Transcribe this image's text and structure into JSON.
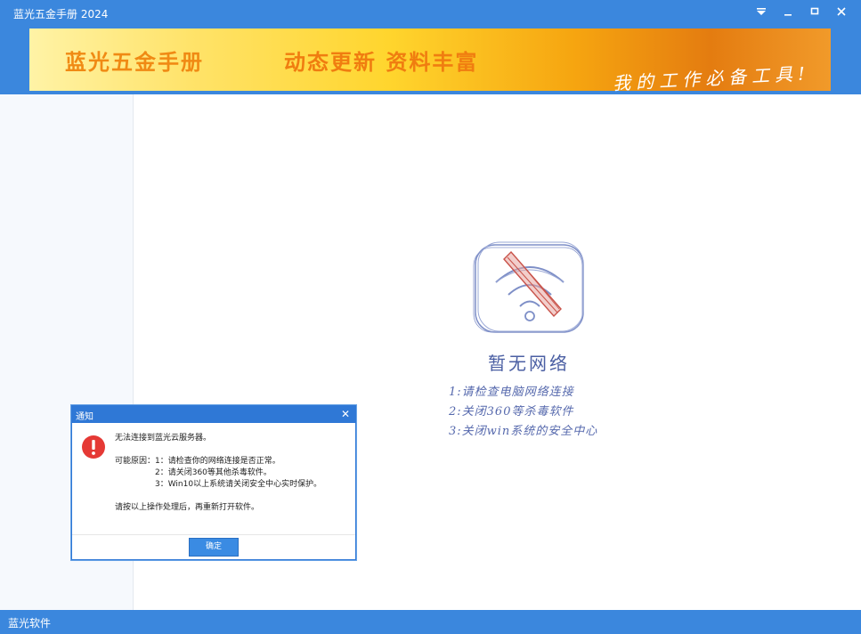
{
  "window": {
    "title": "蓝光五金手册 2024"
  },
  "banner": {
    "title": "蓝光五金手册",
    "slogan": "动态更新 资料丰富",
    "tagline": "我的工作必备工具!"
  },
  "no_network": {
    "title": "暂无网络",
    "tips": [
      "1:请检查电脑网络连接",
      "2:关闭360等杀毒软件",
      "3:关闭win系统的安全中心"
    ]
  },
  "status_bar": {
    "text": "蓝光软件"
  },
  "dialog": {
    "title": "通知",
    "message": "无法连接到蓝光云服务器。",
    "reasons_label": "可能原因：",
    "reasons": [
      "1：请检查你的网络连接是否正常。",
      "2：请关闭360等其他杀毒软件。",
      "3：Win10以上系统请关闭安全中心实时保护。"
    ],
    "instruction": "请按以上操作处理后，再重新打开软件。",
    "ok_label": "确定"
  },
  "colors": {
    "titlebar": "#3b87dd",
    "dialog_accent": "#2f78d6",
    "error_red": "#e53935"
  }
}
